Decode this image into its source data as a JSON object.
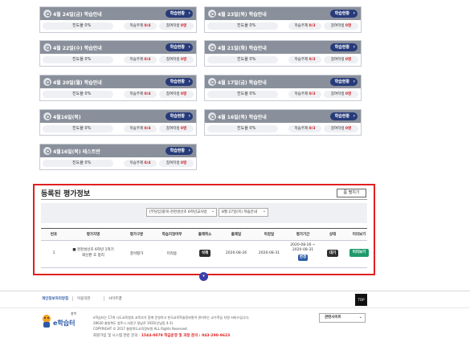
{
  "cards": [
    {
      "title": "4월 24일(금) 학습안내",
      "button": "학습현황",
      "progress_label": "진도율 0%",
      "progress": 0,
      "topics_label": "학습주제",
      "topics": "0/4",
      "participants_label": "참여학생",
      "participants": "0명"
    },
    {
      "title": "4월 23일(목) 학습안내",
      "button": "학습현황",
      "progress_label": "진도율 0%",
      "progress": 0,
      "topics_label": "학습주제",
      "topics": "0/3",
      "participants_label": "참여학생",
      "participants": "0명"
    },
    {
      "title": "4월 22일(수) 학습안내",
      "button": "학습현황",
      "progress_label": "진도율 0%",
      "progress": 0,
      "topics_label": "학습주제",
      "topics": "0/4",
      "participants_label": "참여학생",
      "participants": "0명"
    },
    {
      "title": "4월 21일(화) 학습안내",
      "button": "학습현황",
      "progress_label": "진도율 0%",
      "progress": 0,
      "topics_label": "학습주제",
      "topics": "0/3",
      "participants_label": "참여학생",
      "participants": "0명"
    },
    {
      "title": "4월 20일(월) 학습안내",
      "button": "학습현황",
      "progress_label": "진도율 0%",
      "progress": 0,
      "topics_label": "학습주제",
      "topics": "0/4",
      "participants_label": "참여학생",
      "participants": "0명"
    },
    {
      "title": "4월 17일(금) 학습안내",
      "button": "학습현황",
      "progress_label": "진도율 0%",
      "progress": 0,
      "topics_label": "학습주제",
      "topics": "0/3",
      "participants_label": "참여학생",
      "participants": "0명"
    },
    {
      "title": "4월16일(목)",
      "button": "학습현황",
      "progress_label": "진도율 0%",
      "progress": 0,
      "topics_label": "학습주제",
      "topics": "0/4",
      "participants_label": "참여학생",
      "participants": "0명"
    },
    {
      "title": "4월 16일(목) 학습안내",
      "button": "학습현황",
      "progress_label": "진도율 0%",
      "progress": 0,
      "topics_label": "학습주제",
      "topics": "0/3",
      "participants_label": "참여학생",
      "participants": "0명"
    },
    {
      "title": "4월16일(목) 테스트반",
      "button": "학습현황",
      "progress_label": "진도율 0%",
      "progress": 0,
      "topics_label": "학습주제",
      "topics": "0/4",
      "participants_label": "참여학생",
      "participants": "0명"
    }
  ],
  "eval": {
    "title": "등록된 평가정보",
    "expand_button": "좀 펼치기",
    "select_class": "[부담임]충북-천천성산초 6학년교사방",
    "select_day": "8월 27일(목) 학습안내",
    "headers": [
      "번호",
      "평가지명",
      "평가구분",
      "학습지정여부",
      "출제취소",
      "출제일",
      "마감일",
      "평가기간",
      "상태",
      "미리보기"
    ],
    "rows": [
      {
        "no": "1",
        "name1": "■ 천천성산초 6학년 1학기",
        "name2": "회신판 초 정리",
        "type": "결석평가",
        "assigned": "미적용",
        "cancel": "삭제",
        "start": "2020-08-26",
        "end": "2020-08-31",
        "period1": "2020-08-26 ~",
        "period2": "2020-08-31",
        "period_btn": "변경",
        "status": "대기",
        "preview": "미리보기"
      }
    ]
  },
  "footer": {
    "privacy": "개인정보처리방침",
    "terms": "이용약관",
    "sitemap": "사이트맵",
    "top": "TOP",
    "logo_small": "충북",
    "logo_text": "e학습터",
    "info1": "e학습터는 17개 시도교육청과 교육부가 함께 운영하고 한국교육학술정보원이 관리하는 교수학습 지원 서비스입니다.",
    "info2": "28630 충청북도 청주시 서원구 청남로 1935(산남동 4-3)",
    "info3": "COPYRIGHT © 2017 충청북도교육정보원 ALL Rights Reserved.",
    "phone_label": "회원가입 및 시스템 관련 문의 :",
    "phone": "1544-0079 학급운영 및 과정 문의 : 043-290-9623",
    "site_select": "관련사이트"
  }
}
